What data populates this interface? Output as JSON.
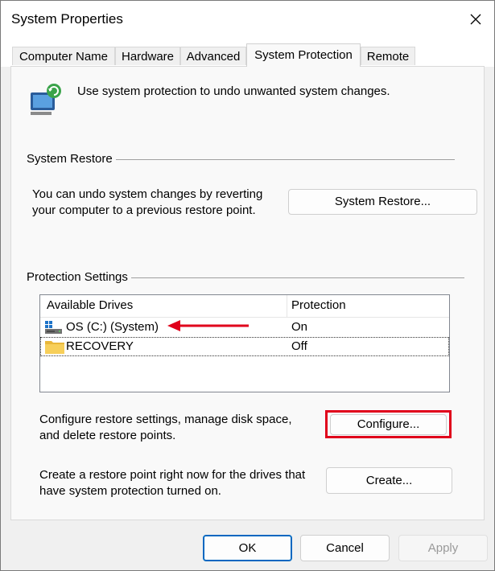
{
  "window": {
    "title": "System Properties"
  },
  "tabs": [
    {
      "label": "Computer Name"
    },
    {
      "label": "Hardware"
    },
    {
      "label": "Advanced"
    },
    {
      "label": "System Protection",
      "active": true
    },
    {
      "label": "Remote"
    }
  ],
  "intro": {
    "text": "Use system protection to undo unwanted system changes.",
    "icon": "computer-restore-icon"
  },
  "system_restore": {
    "group_title": "System Restore",
    "description_line1": "You can undo system changes by reverting",
    "description_line2": "your computer to a previous restore point.",
    "button_label": "System Restore..."
  },
  "protection": {
    "group_title": "Protection Settings",
    "columns": [
      "Available Drives",
      "Protection"
    ],
    "drives": [
      {
        "name": "OS (C:) (System)",
        "protection": "On",
        "icon": "system-drive-icon"
      },
      {
        "name": "RECOVERY",
        "protection": "Off",
        "icon": "folder-icon"
      }
    ],
    "configure_line1": "Configure restore settings, manage disk space,",
    "configure_line2": "and delete restore points.",
    "configure_button": "Configure...",
    "create_line1": "Create a restore point right now for the drives that",
    "create_line2": "have system protection turned on.",
    "create_button": "Create..."
  },
  "footer": {
    "ok": "OK",
    "cancel": "Cancel",
    "apply": "Apply"
  },
  "colors": {
    "annotation_red": "#e0001b",
    "focus_blue": "#0067c0"
  }
}
